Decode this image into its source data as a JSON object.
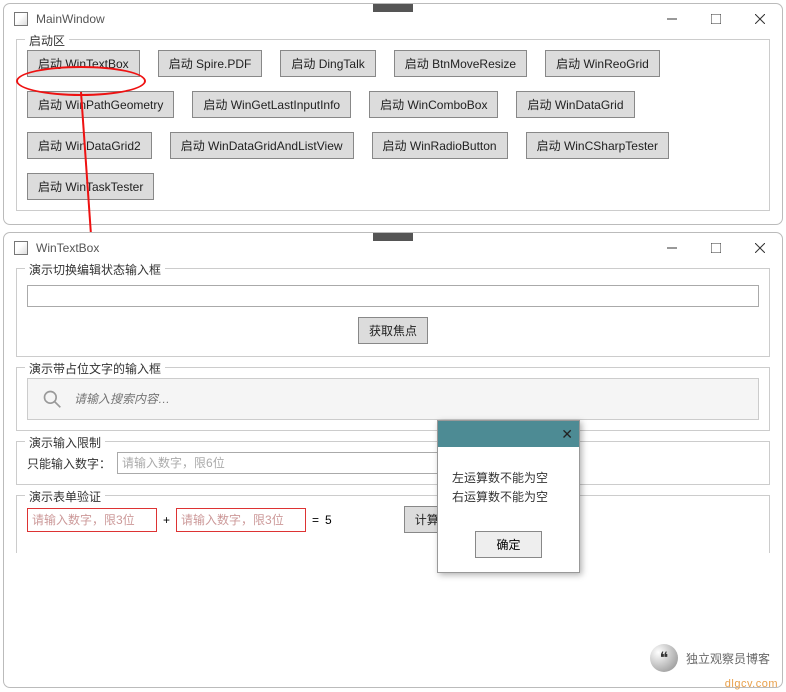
{
  "mainWindow": {
    "title": "MainWindow",
    "groupLabel": "启动区",
    "buttons": [
      "启动 WinTextBox",
      "启动 Spire.PDF",
      "启动 DingTalk",
      "启动 BtnMoveResize",
      "启动 WinReoGrid",
      "启动 WinPathGeometry",
      "启动 WinGetLastInputInfo",
      "启动 WinComboBox",
      "启动 WinDataGrid",
      "启动 WinDataGrid2",
      "启动 WinDataGridAndListView",
      "启动 WinRadioButton",
      "启动 WinCSharpTester",
      "启动 WinTaskTester"
    ]
  },
  "childWindow": {
    "title": "WinTextBox",
    "section1": {
      "label": "演示切换编辑状态输入框",
      "focusBtn": "获取焦点"
    },
    "section2": {
      "label": "演示带占位文字的输入框",
      "placeholder": "请输入搜索内容…"
    },
    "section3": {
      "label": "演示输入限制",
      "rowLabel": "只能输入数字：",
      "placeholder": "请输入数字，限6位"
    },
    "section4": {
      "label": "演示表单验证",
      "lhsPlaceholder": "请输入数字，限3位",
      "rhsPlaceholder": "请输入数字，限3位",
      "plus": "+",
      "equals": "=",
      "result": "5",
      "calcBtn": "计算"
    }
  },
  "dialog": {
    "line1": "左运算数不能为空",
    "line2": "右运算数不能为空",
    "okBtn": "确定"
  },
  "watermark": {
    "text": "独立观察员博客",
    "domain": "dlgcv.com"
  }
}
